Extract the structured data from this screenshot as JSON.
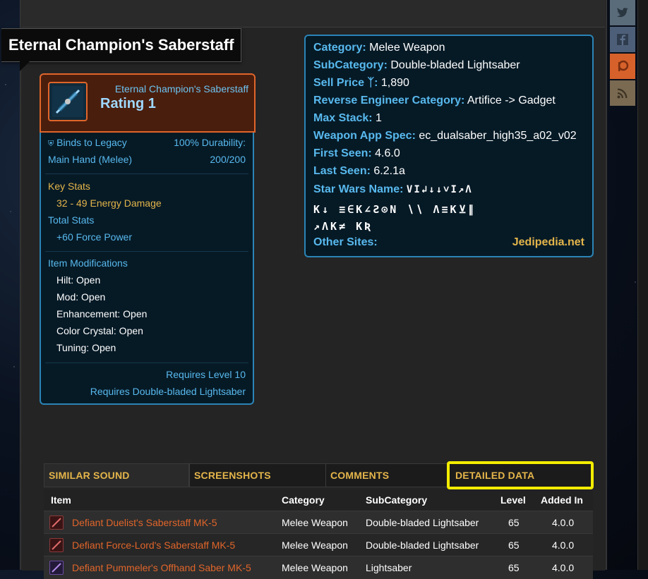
{
  "title": "Eternal Champion's Saberstaff",
  "card": {
    "name": "Eternal Champion's Saberstaff",
    "rating": "Rating 1",
    "binds": "Binds to Legacy",
    "durability_label": "100% Durability:",
    "slot": "Main Hand (Melee)",
    "durability_value": "200/200",
    "key_stats_label": "Key Stats",
    "key_stat": "32 - 49 Energy Damage",
    "total_stats_label": "Total Stats",
    "total_stat": "+60 Force Power",
    "mods_label": "Item Modifications",
    "mods": [
      "Hilt: Open",
      "Mod: Open",
      "Enhancement: Open",
      "Color Crystal: Open",
      "Tuning: Open"
    ],
    "req_level": "Requires Level 10",
    "req_skill": "Requires Double-bladed Lightsaber"
  },
  "info": {
    "category_label": "Category:",
    "category": "Melee Weapon",
    "subcategory_label": "SubCategory:",
    "subcategory": "Double-bladed Lightsaber",
    "sell_label": "Sell Price",
    "sell": "1,890",
    "re_label": "Reverse Engineer Category:",
    "re": "Artifice -> Gadget",
    "stack_label": "Max Stack:",
    "stack": "1",
    "spec_label": "Weapon App Spec:",
    "spec": "ec_dualsaber_high35_a02_v02",
    "first_label": "First Seen:",
    "first": "4.6.0",
    "last_label": "Last Seen:",
    "last": "6.2.1a",
    "sw_label": "Star Wars Name:",
    "sw_line1": "VI↲↓↓˅Ι↗Λ",
    "sw_line2": "K↓ ≡∈K∠Ƨ⊙Ν ∖∖ Λ≡K⊻∥",
    "sw_line3": "↗ΛK≠ KƦ",
    "other_label": "Other Sites:",
    "other_link": "Jedipedia.net"
  },
  "tabs": [
    "SIMILAR SOUND",
    "SCREENSHOTS",
    "COMMENTS",
    "DETAILED DATA"
  ],
  "table": {
    "headers": [
      "Item",
      "Category",
      "SubCategory",
      "Level",
      "Added In"
    ],
    "rows": [
      {
        "item": "Defiant Duelist's Saberstaff MK-5",
        "category": "Melee Weapon",
        "subcategory": "Double-bladed Lightsaber",
        "level": "65",
        "added": "4.0.0"
      },
      {
        "item": "Defiant Force-Lord's Saberstaff MK-5",
        "category": "Melee Weapon",
        "subcategory": "Double-bladed Lightsaber",
        "level": "65",
        "added": "4.0.0"
      },
      {
        "item": "Defiant Pummeler's Offhand Saber MK-5",
        "category": "Melee Weapon",
        "subcategory": "Lightsaber",
        "level": "65",
        "added": "4.0.0"
      }
    ]
  },
  "colors": {
    "accent_cyan": "#58b9ee",
    "accent_gold": "#e4b54a",
    "accent_orange": "#e0652a",
    "highlight": "#f2ec00"
  },
  "social": [
    "twitter-icon",
    "facebook-icon",
    "patreon-icon",
    "rss-icon"
  ]
}
